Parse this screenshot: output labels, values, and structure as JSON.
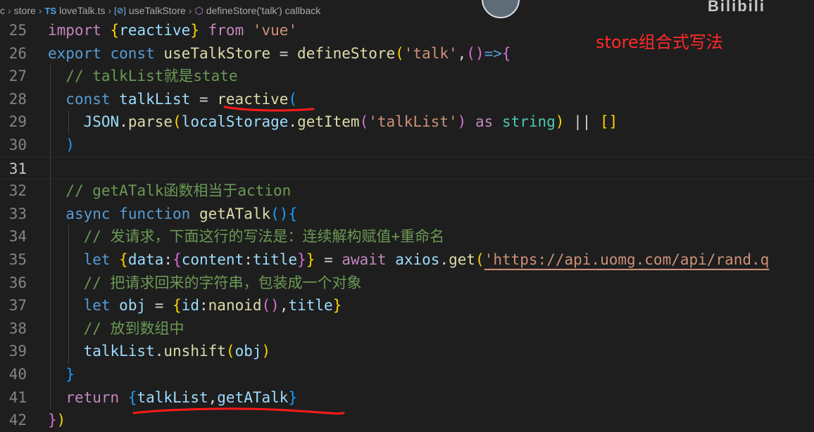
{
  "breadcrumb": {
    "lead": "c",
    "folder": "store",
    "ts_badge": "TS",
    "file": "loveTalk.ts",
    "var_badge": "[⊘]",
    "symbol": "useTalkStore",
    "callback": "defineStore('talk') callback"
  },
  "watermark": "Bilibili",
  "annotation": "store组合式写法",
  "colors": {
    "background": "#1e1e1e",
    "keyword": "#569cd6",
    "control_keyword": "#c586c0",
    "function": "#dcdcaa",
    "variable": "#9cdcfe",
    "string": "#ce9178",
    "comment": "#6a9955",
    "annotation": "#ff2a2a"
  },
  "line_numbers": [
    "25",
    "26",
    "27",
    "28",
    "29",
    "30",
    "31",
    "32",
    "33",
    "34",
    "35",
    "36",
    "37",
    "38",
    "39",
    "40",
    "41",
    "42"
  ],
  "active_line": "31",
  "lines": [
    [
      [
        "kw2",
        "import"
      ],
      [
        "plain",
        " "
      ],
      [
        "brk1",
        "{"
      ],
      [
        "var2",
        "reactive"
      ],
      [
        "brk1",
        "}"
      ],
      [
        "plain",
        " "
      ],
      [
        "kw2",
        "from"
      ],
      [
        "plain",
        " "
      ],
      [
        "str",
        "'vue'"
      ]
    ],
    [
      [
        "kw",
        "export"
      ],
      [
        "plain",
        " "
      ],
      [
        "kw",
        "const"
      ],
      [
        "plain",
        " "
      ],
      [
        "fn",
        "useTalkStore"
      ],
      [
        "plain",
        " = "
      ],
      [
        "fn",
        "defineStore"
      ],
      [
        "brk1",
        "("
      ],
      [
        "str",
        "'talk'"
      ],
      [
        "plain",
        ","
      ],
      [
        "brk2",
        "("
      ],
      [
        "brk2",
        ")"
      ],
      [
        "kw",
        "=>"
      ],
      [
        "brk2",
        "{"
      ]
    ],
    [
      [
        "plain",
        "  "
      ],
      [
        "cmt",
        "// talkList就是state"
      ]
    ],
    [
      [
        "plain",
        "  "
      ],
      [
        "kw",
        "const"
      ],
      [
        "plain",
        " "
      ],
      [
        "var2",
        "talkList"
      ],
      [
        "plain",
        " = "
      ],
      [
        "fn",
        "reactive"
      ],
      [
        "brk3",
        "("
      ]
    ],
    [
      [
        "plain",
        "    "
      ],
      [
        "var2",
        "JSON"
      ],
      [
        "plain",
        "."
      ],
      [
        "fn",
        "parse"
      ],
      [
        "brk1",
        "("
      ],
      [
        "var2",
        "localStorage"
      ],
      [
        "plain",
        "."
      ],
      [
        "fn",
        "getItem"
      ],
      [
        "brk2",
        "("
      ],
      [
        "str",
        "'talkList'"
      ],
      [
        "brk2",
        ")"
      ],
      [
        "plain",
        " "
      ],
      [
        "kw2",
        "as"
      ],
      [
        "plain",
        " "
      ],
      [
        "cls",
        "string"
      ],
      [
        "brk1",
        ")"
      ],
      [
        "plain",
        " || "
      ],
      [
        "brk1",
        "[]"
      ]
    ],
    [
      [
        "plain",
        "  "
      ],
      [
        "brk3",
        ")"
      ]
    ],
    [
      [
        "plain",
        ""
      ]
    ],
    [
      [
        "plain",
        "  "
      ],
      [
        "cmt",
        "// getATalk函数相当于action"
      ]
    ],
    [
      [
        "plain",
        "  "
      ],
      [
        "kw",
        "async"
      ],
      [
        "plain",
        " "
      ],
      [
        "kw",
        "function"
      ],
      [
        "plain",
        " "
      ],
      [
        "fn",
        "getATalk"
      ],
      [
        "brk3",
        "()"
      ],
      [
        "brk3",
        "{"
      ]
    ],
    [
      [
        "plain",
        "    "
      ],
      [
        "cmt",
        "// 发请求，下面这行的写法是：连续解构赋值+重命名"
      ]
    ],
    [
      [
        "plain",
        "    "
      ],
      [
        "kw",
        "let"
      ],
      [
        "plain",
        " "
      ],
      [
        "brk1",
        "{"
      ],
      [
        "var2",
        "data"
      ],
      [
        "plain",
        ":"
      ],
      [
        "brk2",
        "{"
      ],
      [
        "var2",
        "content"
      ],
      [
        "plain",
        ":"
      ],
      [
        "var2",
        "title"
      ],
      [
        "brk2",
        "}"
      ],
      [
        "brk1",
        "}"
      ],
      [
        "plain",
        " = "
      ],
      [
        "kw2",
        "await"
      ],
      [
        "plain",
        " "
      ],
      [
        "var2",
        "axios"
      ],
      [
        "plain",
        "."
      ],
      [
        "fn",
        "get"
      ],
      [
        "brk1",
        "("
      ],
      [
        "str",
        "'https://api.uomg.com/api/rand.q"
      ]
    ],
    [
      [
        "plain",
        "    "
      ],
      [
        "cmt",
        "// 把请求回来的字符串，包装成一个对象"
      ]
    ],
    [
      [
        "plain",
        "    "
      ],
      [
        "kw",
        "let"
      ],
      [
        "plain",
        " "
      ],
      [
        "var2",
        "obj"
      ],
      [
        "plain",
        " = "
      ],
      [
        "brk1",
        "{"
      ],
      [
        "var2",
        "id"
      ],
      [
        "plain",
        ":"
      ],
      [
        "fn",
        "nanoid"
      ],
      [
        "brk2",
        "()"
      ],
      [
        "plain",
        ","
      ],
      [
        "var2",
        "title"
      ],
      [
        "brk1",
        "}"
      ]
    ],
    [
      [
        "plain",
        "    "
      ],
      [
        "cmt",
        "// 放到数组中"
      ]
    ],
    [
      [
        "plain",
        "    "
      ],
      [
        "var2",
        "talkList"
      ],
      [
        "plain",
        "."
      ],
      [
        "fn",
        "unshift"
      ],
      [
        "brk1",
        "("
      ],
      [
        "var2",
        "obj"
      ],
      [
        "brk1",
        ")"
      ]
    ],
    [
      [
        "plain",
        "  "
      ],
      [
        "brk3",
        "}"
      ]
    ],
    [
      [
        "plain",
        "  "
      ],
      [
        "kw2",
        "return"
      ],
      [
        "plain",
        " "
      ],
      [
        "brk3",
        "{"
      ],
      [
        "var2",
        "talkList"
      ],
      [
        "plain",
        ","
      ],
      [
        "var2",
        "getATalk"
      ],
      [
        "brk3",
        "}"
      ]
    ],
    [
      [
        "brk2",
        "}"
      ],
      [
        "brk1",
        ")"
      ]
    ]
  ]
}
